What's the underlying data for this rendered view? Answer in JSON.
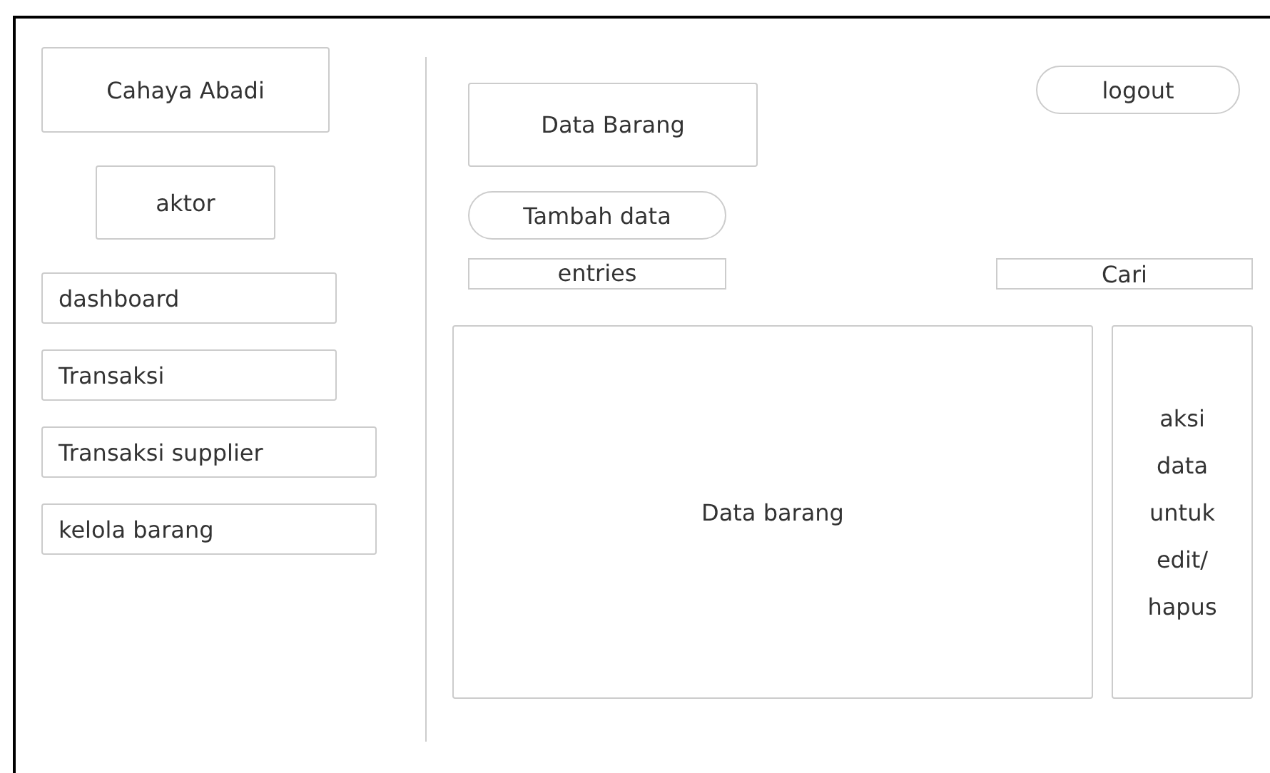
{
  "sidebar": {
    "brand": "Cahaya Abadi",
    "actor": "aktor",
    "items": [
      {
        "label": "dashboard",
        "wide": false
      },
      {
        "label": "Transaksi",
        "wide": false
      },
      {
        "label": "Transaksi supplier",
        "wide": true
      },
      {
        "label": "kelola barang",
        "wide": true
      }
    ]
  },
  "header": {
    "title": "Data Barang",
    "logout": "logout"
  },
  "add_button": "Tambah data",
  "entries": {
    "label": "entries"
  },
  "search": {
    "placeholder": "Cari"
  },
  "table": {
    "content": "Data barang",
    "actions": "aksi data untuk edit/ hapus"
  }
}
